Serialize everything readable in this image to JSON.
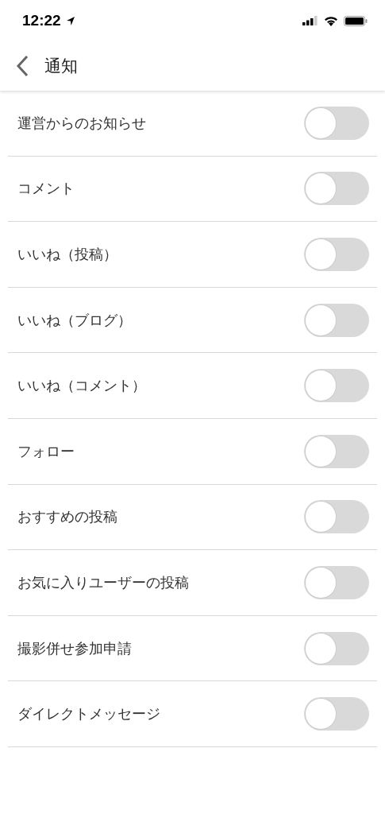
{
  "status_bar": {
    "time": "12:22"
  },
  "header": {
    "title": "通知"
  },
  "settings": [
    {
      "label": "運営からのお知らせ",
      "on": false
    },
    {
      "label": "コメント",
      "on": false
    },
    {
      "label": "いいね（投稿）",
      "on": false
    },
    {
      "label": "いいね（ブログ）",
      "on": false
    },
    {
      "label": "いいね（コメント）",
      "on": false
    },
    {
      "label": "フォロー",
      "on": false
    },
    {
      "label": "おすすめの投稿",
      "on": false
    },
    {
      "label": "お気に入りユーザーの投稿",
      "on": false
    },
    {
      "label": "撮影併せ参加申請",
      "on": false
    },
    {
      "label": "ダイレクトメッセージ",
      "on": false
    }
  ]
}
